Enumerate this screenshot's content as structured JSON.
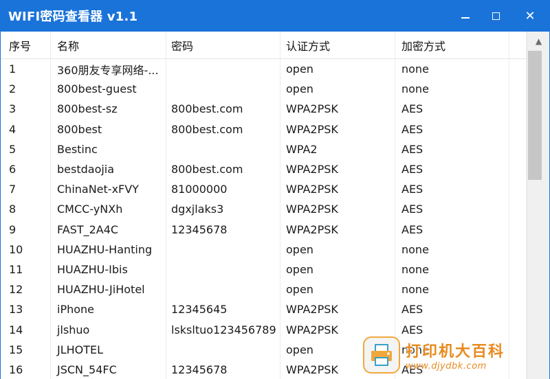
{
  "window": {
    "title": "WIFI密码查看器 v1.1",
    "controls": {
      "minimize_icon": "minimize-icon",
      "maximize_icon": "maximize-icon",
      "close_icon": "close-icon",
      "close_glyph": "✕"
    }
  },
  "table": {
    "columns": [
      "序号",
      "名称",
      "密码",
      "认证方式",
      "加密方式"
    ],
    "rows": [
      [
        "1",
        "360朋友专享网络-...",
        "",
        "open",
        "none"
      ],
      [
        "2",
        "800best-guest",
        "",
        "open",
        "none"
      ],
      [
        "3",
        "800best-sz",
        "800best.com",
        "WPA2PSK",
        "AES"
      ],
      [
        "4",
        "800best",
        "800best.com",
        "WPA2PSK",
        "AES"
      ],
      [
        "5",
        "Bestinc",
        "",
        "WPA2",
        "AES"
      ],
      [
        "6",
        "bestdaojia",
        "800best.com",
        "WPA2PSK",
        "AES"
      ],
      [
        "7",
        "ChinaNet-xFVY",
        "81000000",
        "WPA2PSK",
        "AES"
      ],
      [
        "8",
        "CMCC-yNXh",
        "dgxjlaks3",
        "WPA2PSK",
        "AES"
      ],
      [
        "9",
        "FAST_2A4C",
        "12345678",
        "WPA2PSK",
        "AES"
      ],
      [
        "10",
        "HUAZHU-Hanting",
        "",
        "open",
        "none"
      ],
      [
        "11",
        "HUAZHU-Ibis",
        "",
        "open",
        "none"
      ],
      [
        "12",
        "HUAZHU-JiHotel",
        "",
        "open",
        "none"
      ],
      [
        "13",
        "iPhone",
        "12345645",
        "WPA2PSK",
        "AES"
      ],
      [
        "14",
        "jlshuo",
        "lsksltuo123456789",
        "WPA2PSK",
        "AES"
      ],
      [
        "15",
        "JLHOTEL",
        "",
        "open",
        "none"
      ],
      [
        "16",
        "JSCN_54FC",
        "12345678",
        "WPA2PSK",
        "AES"
      ]
    ]
  },
  "scrollbar": {
    "up_arrow": "▲"
  },
  "watermark": {
    "text_cn": "打印机大百科",
    "url": "www.djydbk.com"
  }
}
